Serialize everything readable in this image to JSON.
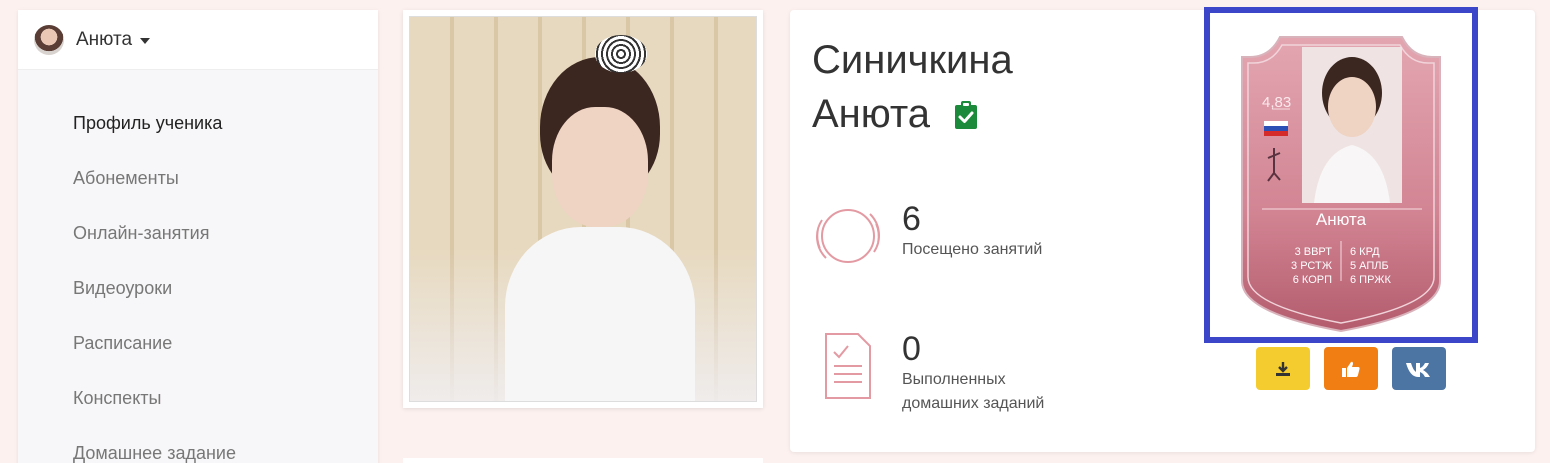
{
  "user_menu": {
    "name": "Анюта"
  },
  "sidebar": {
    "items": [
      {
        "label": "Профиль ученика",
        "active": true
      },
      {
        "label": "Абонементы"
      },
      {
        "label": "Онлайн-занятия"
      },
      {
        "label": "Видеоуроки"
      },
      {
        "label": "Расписание"
      },
      {
        "label": "Конспекты"
      },
      {
        "label": "Домашнее задание"
      }
    ]
  },
  "profile": {
    "last_name": "Синичкина",
    "first_name": "Анюта",
    "stats": [
      {
        "value": "6",
        "label": "Посещено занятий"
      },
      {
        "value": "0",
        "label": "Выполненных домашних заданий"
      }
    ]
  },
  "player_card": {
    "rating": "4,83",
    "name": "Анюта",
    "left_stats": [
      "3 ВВРТ",
      "3 РСТЖ",
      "6 КОРП"
    ],
    "right_stats": [
      "6 КРД",
      "5 АПЛБ",
      "6 ПРЖК"
    ]
  },
  "colors": {
    "accent": "#3b46c8",
    "card_pink": "#c47686",
    "download": "#f5cc2f",
    "like": "#f07e13",
    "vk": "#4c75a3",
    "verified": "#1b8a3a"
  },
  "icons": {
    "download": "download-icon",
    "like": "thumbs-up-icon",
    "vk": "vk-icon",
    "verified": "clipboard-check-icon"
  }
}
